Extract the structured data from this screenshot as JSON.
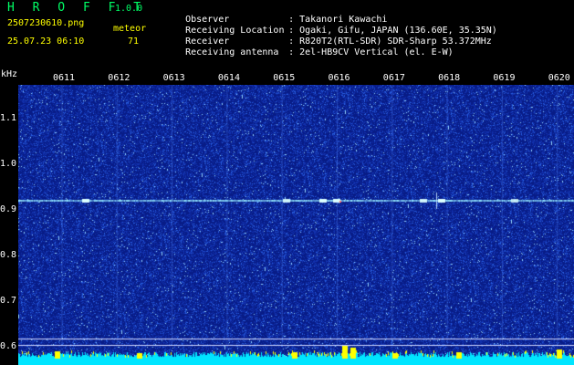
{
  "header": {
    "app_title": "H R O F F T",
    "app_version": "1.0.0",
    "file_name": "2507230610.png",
    "date_time": "25.07.23 06:10",
    "meteor_label": "meteor",
    "meteor_count": "71",
    "info": [
      {
        "key": "Observer",
        "value": "Takanori Kawachi"
      },
      {
        "key": "Receiving Location",
        "value": "Ogaki, Gifu, JAPAN (136.60E, 35.35N)"
      },
      {
        "key": "Receiver",
        "value": "R820T2(RTL-SDR) SDR-Sharp 53.372MHz"
      },
      {
        "key": "Receiving antenna",
        "value": "2el-HB9CV Vertical (el. E-W)"
      }
    ]
  },
  "spectrogram": {
    "y_unit": "kHz",
    "y_ticks": [
      "1.1",
      "1.0",
      "0.9",
      "0.8",
      "0.7",
      "0.6"
    ],
    "time_labels": [
      "0611",
      "0612",
      "0613",
      "0614",
      "0615",
      "0616",
      "0617",
      "0618",
      "0619",
      "0620"
    ],
    "colors": {
      "background": "#0a1f8a",
      "speckle": "#2a5adf",
      "bright": "#9ad8ff",
      "signal": "#aef2ff",
      "level_bar": "#00e5ff",
      "level_peak": "#ffff00"
    }
  }
}
